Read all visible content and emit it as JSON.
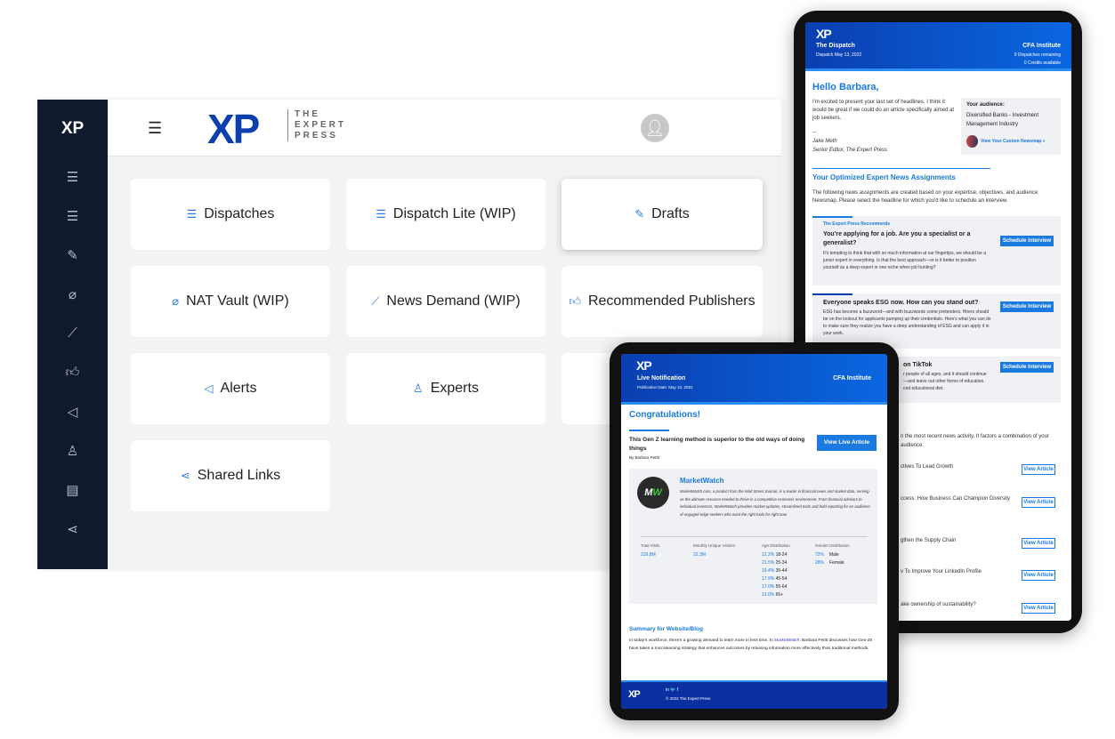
{
  "colors": {
    "sidebar": "#0f1a2e",
    "accent": "#2f7de1",
    "brand": "#0a3fb0"
  },
  "dashboard": {
    "sidebar": {
      "logo": "XP",
      "icons": [
        "list-icon",
        "list-icon",
        "edit-icon",
        "paperclip-icon",
        "chart-icon",
        "thumbs-up-icon",
        "megaphone-icon",
        "users-icon",
        "document-icon",
        "share-icon"
      ]
    },
    "header": {
      "logo_mark": "XP",
      "logo_words": [
        "THE",
        "EXPERT",
        "PRESS"
      ]
    },
    "cards": [
      {
        "label": "Dispatches",
        "icon": "list-icon"
      },
      {
        "label": "Dispatch Lite (WIP)",
        "icon": "list-icon"
      },
      {
        "label": "Drafts",
        "icon": "edit-icon"
      },
      {
        "label": "NAT Vault (WIP)",
        "icon": "paperclip-icon"
      },
      {
        "label": "News Demand (WIP)",
        "icon": "chart-icon"
      },
      {
        "label": "Recommended Publishers",
        "icon": "thumbs-up-icon"
      },
      {
        "label": "Alerts",
        "icon": "megaphone-icon"
      },
      {
        "label": "Experts",
        "icon": "users-icon"
      },
      {
        "label": "",
        "icon": ""
      },
      {
        "label": "Shared Links",
        "icon": "share-icon"
      }
    ]
  },
  "dispatch": {
    "title": "The Dispatch",
    "date": "Dispatch May 13, 2022",
    "client": "CFA Institute",
    "remaining": "0 Dispatches remaining",
    "credits": "0 Credits available",
    "greeting": "Hello Barbara,",
    "intro": "I'm excited to present your last set of headlines. I think it would be great if we could do an article specifically aimed at job seekers.",
    "dash": "--",
    "signer": "Jake Meth",
    "signer_title": "Senior Editor, The Expert Press",
    "audience_label": "Your audience:",
    "audience": "Diversified Banks - Investment Management Industry",
    "newsmap_link": "View Your Custom Newsmap »",
    "section_title": "Your Optimized Expert News Assignments",
    "section_desc": "The following news assignments are created based on your expertise, objectives, and audience Newsmap. Please select the headline for which you'd like to schedule an interview.",
    "recommends": "The Expert Press Recommends",
    "schedule_label": "Schedule Interview",
    "assignments": [
      {
        "title": "You're applying for a job. Are you a specialist or a generalist?",
        "desc": "It's tempting to think that with so much information at our fingertips, we should be a junior expert in everything. Is that the best approach—or is it better to position yourself as a deep expert in one niche when job hunting?"
      },
      {
        "title": "Everyone speaks ESG now. How can you stand out?",
        "desc": "ESG has become a buzzword—and with buzzwords come pretenders. Hirers should be on the lookout for applicants pumping up their credentials. Here's what you can do to make sure they realize you have a deep understanding of ESG and can apply it in your work."
      },
      {
        "title": "on TikTok",
        "desc_lines": [
          "r people of all ages, and it should continue",
          "—and leave out other forms of education.",
          "ced educational diet."
        ]
      }
    ],
    "news_desc_lines": [
      "n the most recent news activity. It factors a combination of your",
      "audience."
    ],
    "view_label": "View Article",
    "articles": [
      "ctives To Lead Growth",
      "ccess: How Business Can Champion Diversity",
      "gthen the Supply Chain",
      "v To Improve Your LinkedIn Profile",
      "ake ownership of sustainability?"
    ]
  },
  "live": {
    "title": "Live Notification",
    "date": "Publication Date: May 13, 2022",
    "client": "CFA Institute",
    "heading": "Congratulations!",
    "article_title": "This Gen Z learning method is superior to the old ways of doing things",
    "byline": "By Barbara Petitt",
    "view_live": "View Live Article",
    "publisher": "MarketWatch",
    "publisher_desc": "MarketWatch.com, a product from the Wall Street Journal, is a leader in financial news and market data, serving as the ultimate resource needed to thrive in a competitive economic environment. From financial advisors to individual investors, MarketWatch provides market updates, streamlined tools and bold reporting for an audience of engaged edge-seekers who want the right tools for right now.",
    "stats": {
      "visits_label": "Total Visits",
      "visits": "229.8M",
      "unique_label": "Monthly Unique Visitors",
      "unique": "22.3M",
      "age_label": "Age Distribution",
      "ages": [
        {
          "pct": "12.2%",
          "range": "18-24"
        },
        {
          "pct": "21.5%",
          "range": "25-34"
        },
        {
          "pct": "19.4%",
          "range": "35-44"
        },
        {
          "pct": "17.9%",
          "range": "45-54"
        },
        {
          "pct": "17.0%",
          "range": "55-64"
        },
        {
          "pct": "12.0%",
          "range": "65+"
        }
      ],
      "gender_label": "Gender Distribution",
      "genders": [
        {
          "pct": "72%",
          "label": "Male"
        },
        {
          "pct": "28%",
          "label": "Female"
        }
      ]
    },
    "summary_title": "Summary for Website/Blog",
    "summary_pre": "In today's workforce, there's a growing demand to learn more in less time. In ",
    "summary_link": "MarketWatch",
    "summary_post": ", Barbara Petitt discusses how Gen-Zs have taken a microlearning strategy that enhances outcomes by retaining information more effectively than traditional methods.",
    "footer_social": "in  🐦  f",
    "copyright": "© 2022 The Expert Press"
  }
}
